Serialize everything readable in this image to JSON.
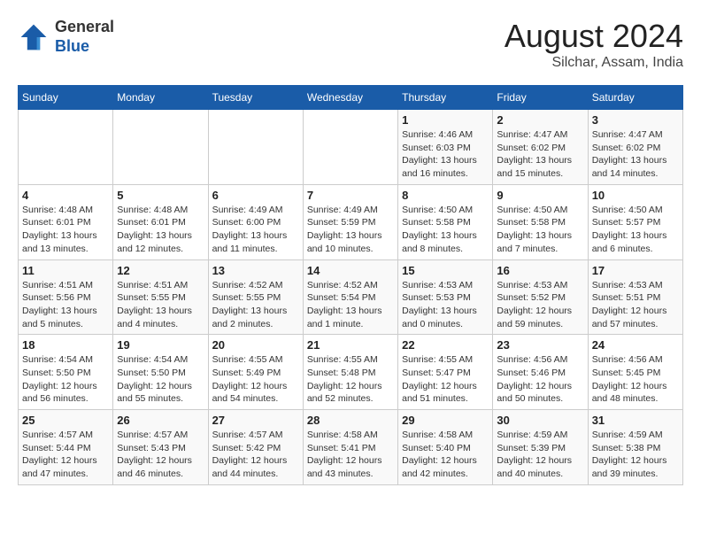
{
  "header": {
    "logo_line1": "General",
    "logo_line2": "Blue",
    "title": "August 2024",
    "subtitle": "Silchar, Assam, India"
  },
  "days_of_week": [
    "Sunday",
    "Monday",
    "Tuesday",
    "Wednesday",
    "Thursday",
    "Friday",
    "Saturday"
  ],
  "weeks": [
    [
      {
        "day": "",
        "detail": ""
      },
      {
        "day": "",
        "detail": ""
      },
      {
        "day": "",
        "detail": ""
      },
      {
        "day": "",
        "detail": ""
      },
      {
        "day": "1",
        "detail": "Sunrise: 4:46 AM\nSunset: 6:03 PM\nDaylight: 13 hours and 16 minutes."
      },
      {
        "day": "2",
        "detail": "Sunrise: 4:47 AM\nSunset: 6:02 PM\nDaylight: 13 hours and 15 minutes."
      },
      {
        "day": "3",
        "detail": "Sunrise: 4:47 AM\nSunset: 6:02 PM\nDaylight: 13 hours and 14 minutes."
      }
    ],
    [
      {
        "day": "4",
        "detail": "Sunrise: 4:48 AM\nSunset: 6:01 PM\nDaylight: 13 hours and 13 minutes."
      },
      {
        "day": "5",
        "detail": "Sunrise: 4:48 AM\nSunset: 6:01 PM\nDaylight: 13 hours and 12 minutes."
      },
      {
        "day": "6",
        "detail": "Sunrise: 4:49 AM\nSunset: 6:00 PM\nDaylight: 13 hours and 11 minutes."
      },
      {
        "day": "7",
        "detail": "Sunrise: 4:49 AM\nSunset: 5:59 PM\nDaylight: 13 hours and 10 minutes."
      },
      {
        "day": "8",
        "detail": "Sunrise: 4:50 AM\nSunset: 5:58 PM\nDaylight: 13 hours and 8 minutes."
      },
      {
        "day": "9",
        "detail": "Sunrise: 4:50 AM\nSunset: 5:58 PM\nDaylight: 13 hours and 7 minutes."
      },
      {
        "day": "10",
        "detail": "Sunrise: 4:50 AM\nSunset: 5:57 PM\nDaylight: 13 hours and 6 minutes."
      }
    ],
    [
      {
        "day": "11",
        "detail": "Sunrise: 4:51 AM\nSunset: 5:56 PM\nDaylight: 13 hours and 5 minutes."
      },
      {
        "day": "12",
        "detail": "Sunrise: 4:51 AM\nSunset: 5:55 PM\nDaylight: 13 hours and 4 minutes."
      },
      {
        "day": "13",
        "detail": "Sunrise: 4:52 AM\nSunset: 5:55 PM\nDaylight: 13 hours and 2 minutes."
      },
      {
        "day": "14",
        "detail": "Sunrise: 4:52 AM\nSunset: 5:54 PM\nDaylight: 13 hours and 1 minute."
      },
      {
        "day": "15",
        "detail": "Sunrise: 4:53 AM\nSunset: 5:53 PM\nDaylight: 13 hours and 0 minutes."
      },
      {
        "day": "16",
        "detail": "Sunrise: 4:53 AM\nSunset: 5:52 PM\nDaylight: 12 hours and 59 minutes."
      },
      {
        "day": "17",
        "detail": "Sunrise: 4:53 AM\nSunset: 5:51 PM\nDaylight: 12 hours and 57 minutes."
      }
    ],
    [
      {
        "day": "18",
        "detail": "Sunrise: 4:54 AM\nSunset: 5:50 PM\nDaylight: 12 hours and 56 minutes."
      },
      {
        "day": "19",
        "detail": "Sunrise: 4:54 AM\nSunset: 5:50 PM\nDaylight: 12 hours and 55 minutes."
      },
      {
        "day": "20",
        "detail": "Sunrise: 4:55 AM\nSunset: 5:49 PM\nDaylight: 12 hours and 54 minutes."
      },
      {
        "day": "21",
        "detail": "Sunrise: 4:55 AM\nSunset: 5:48 PM\nDaylight: 12 hours and 52 minutes."
      },
      {
        "day": "22",
        "detail": "Sunrise: 4:55 AM\nSunset: 5:47 PM\nDaylight: 12 hours and 51 minutes."
      },
      {
        "day": "23",
        "detail": "Sunrise: 4:56 AM\nSunset: 5:46 PM\nDaylight: 12 hours and 50 minutes."
      },
      {
        "day": "24",
        "detail": "Sunrise: 4:56 AM\nSunset: 5:45 PM\nDaylight: 12 hours and 48 minutes."
      }
    ],
    [
      {
        "day": "25",
        "detail": "Sunrise: 4:57 AM\nSunset: 5:44 PM\nDaylight: 12 hours and 47 minutes."
      },
      {
        "day": "26",
        "detail": "Sunrise: 4:57 AM\nSunset: 5:43 PM\nDaylight: 12 hours and 46 minutes."
      },
      {
        "day": "27",
        "detail": "Sunrise: 4:57 AM\nSunset: 5:42 PM\nDaylight: 12 hours and 44 minutes."
      },
      {
        "day": "28",
        "detail": "Sunrise: 4:58 AM\nSunset: 5:41 PM\nDaylight: 12 hours and 43 minutes."
      },
      {
        "day": "29",
        "detail": "Sunrise: 4:58 AM\nSunset: 5:40 PM\nDaylight: 12 hours and 42 minutes."
      },
      {
        "day": "30",
        "detail": "Sunrise: 4:59 AM\nSunset: 5:39 PM\nDaylight: 12 hours and 40 minutes."
      },
      {
        "day": "31",
        "detail": "Sunrise: 4:59 AM\nSunset: 5:38 PM\nDaylight: 12 hours and 39 minutes."
      }
    ]
  ]
}
